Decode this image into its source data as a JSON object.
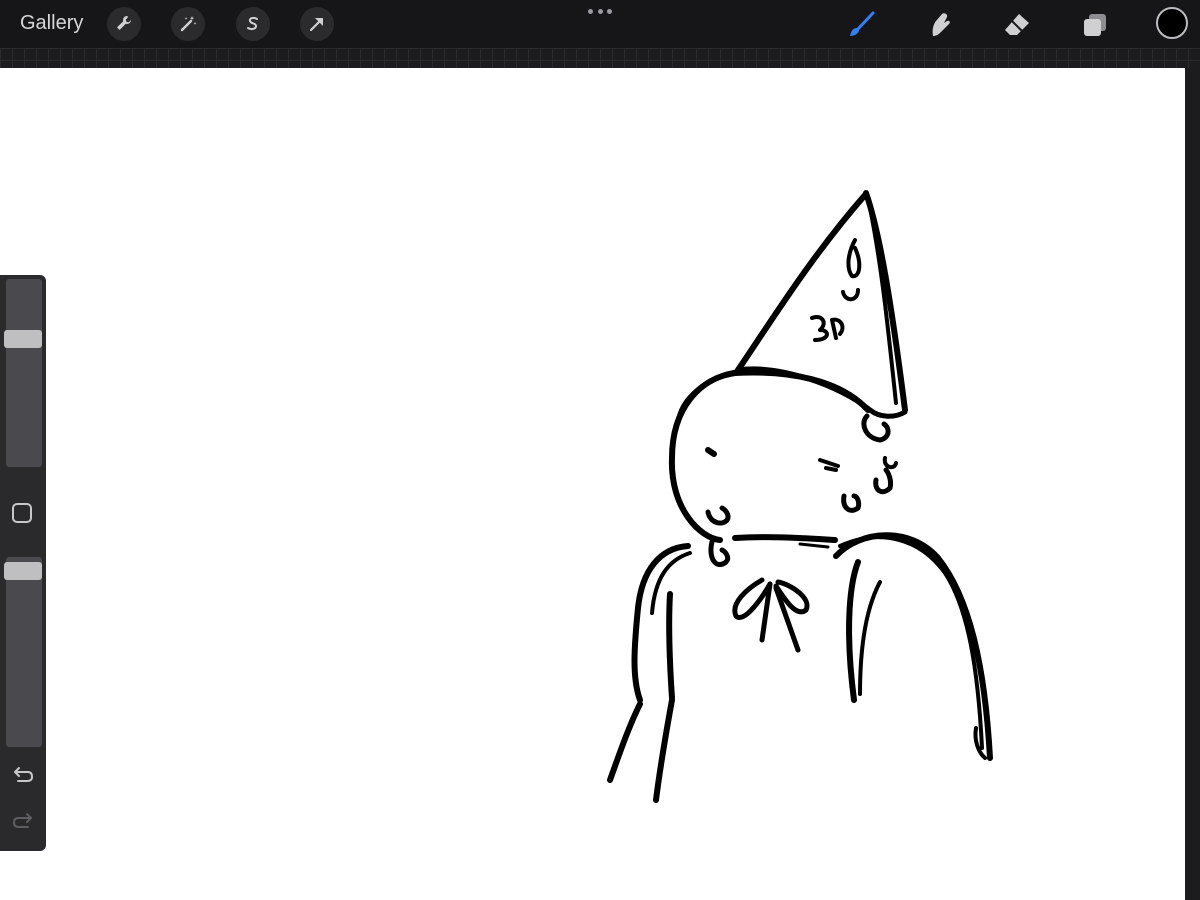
{
  "toolbar": {
    "gallery_label": "Gallery",
    "left_tools": [
      "wrench-icon",
      "magic-wand-icon",
      "selection-s-icon",
      "transform-arrow-icon"
    ],
    "right_tools": [
      "brush-icon",
      "smudge-icon",
      "eraser-icon",
      "layers-icon"
    ],
    "active_tool": "brush",
    "active_color": "#000000",
    "accent": "#2f7ff5"
  },
  "sidebar": {
    "brush_size": 0.7,
    "opacity": 0.97,
    "modify_button": "square-icon",
    "undo": "undo-icon",
    "redo": "redo-icon"
  }
}
